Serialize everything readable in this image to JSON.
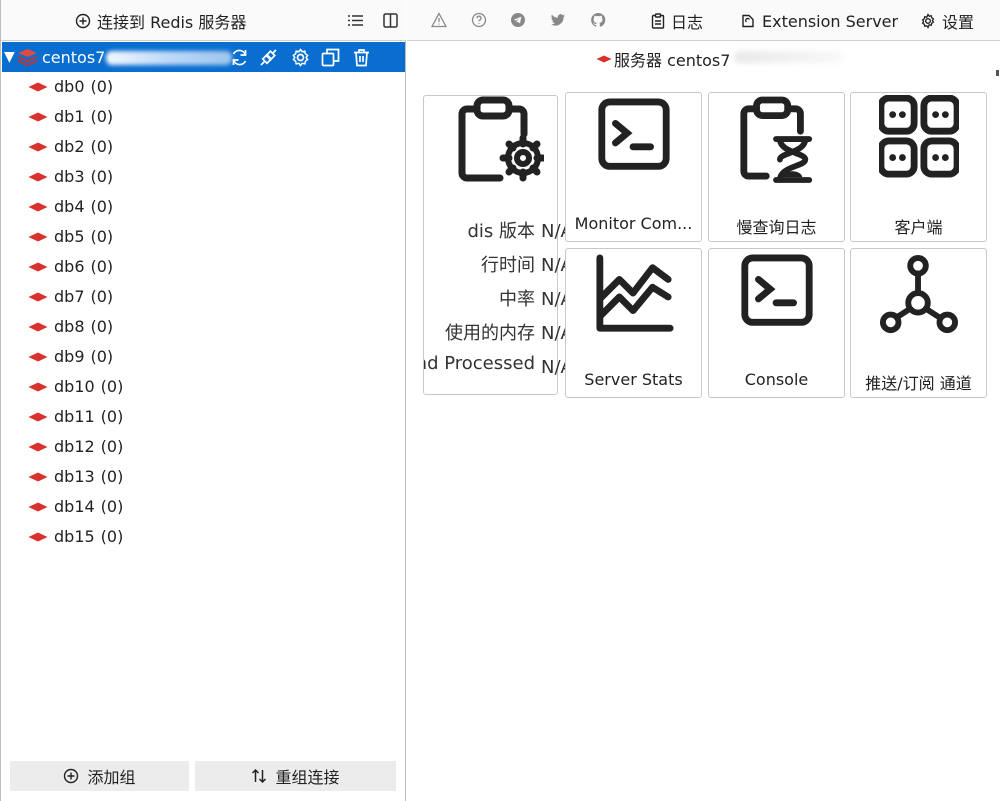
{
  "left_toolbar": {
    "connect_label": "连接到 Redis 服务器",
    "icons": [
      "list-icon",
      "split-view-icon"
    ]
  },
  "tree": {
    "server_name": "centos7",
    "expanded": true,
    "actions": [
      "refresh-icon",
      "connect-plug-icon",
      "gear-icon",
      "copy-icon",
      "trash-icon"
    ],
    "databases": [
      {
        "name": "db0",
        "count": "(0)"
      },
      {
        "name": "db1",
        "count": "(0)"
      },
      {
        "name": "db2",
        "count": "(0)"
      },
      {
        "name": "db3",
        "count": "(0)"
      },
      {
        "name": "db4",
        "count": "(0)"
      },
      {
        "name": "db5",
        "count": "(0)"
      },
      {
        "name": "db6",
        "count": "(0)"
      },
      {
        "name": "db7",
        "count": "(0)"
      },
      {
        "name": "db8",
        "count": "(0)"
      },
      {
        "name": "db9",
        "count": "(0)"
      },
      {
        "name": "db10",
        "count": "(0)"
      },
      {
        "name": "db11",
        "count": "(0)"
      },
      {
        "name": "db12",
        "count": "(0)"
      },
      {
        "name": "db13",
        "count": "(0)"
      },
      {
        "name": "db14",
        "count": "(0)"
      },
      {
        "name": "db15",
        "count": "(0)"
      }
    ]
  },
  "left_footer": {
    "add_group_label": "添加组",
    "regroup_label": "重组连接"
  },
  "right_toolbar": {
    "icons": [
      "warning-icon",
      "help-icon",
      "telegram-icon",
      "twitter-icon",
      "github-icon"
    ],
    "log_label": "日志",
    "extension_label": "Extension Server",
    "settings_label": "设置"
  },
  "server_page": {
    "title": "服务器 centos7",
    "info_rows": [
      {
        "key": "dis 版本",
        "value": "N/A"
      },
      {
        "key": "行时间",
        "value": "N/A"
      },
      {
        "key": "中率",
        "value": "N/A"
      },
      {
        "key": "使用的内存",
        "value": "N/A"
      },
      {
        "key": "nd Processed",
        "value": "N/A"
      }
    ],
    "tiles": [
      {
        "label": "Monitor Com...",
        "icon": "terminal-icon"
      },
      {
        "label": "慢查询日志",
        "icon": "clipboard-hourglass-icon"
      },
      {
        "label": "客户端",
        "icon": "grid-users-icon"
      },
      {
        "label": "Server Stats",
        "icon": "chart-line-icon"
      },
      {
        "label": "Console",
        "icon": "console-icon"
      },
      {
        "label": "推送/订阅 通道",
        "icon": "pubsub-icon"
      }
    ]
  },
  "colors": {
    "selection": "#0a6ed1",
    "redis_red": "#d9312c",
    "border": "#c8c8c8"
  }
}
